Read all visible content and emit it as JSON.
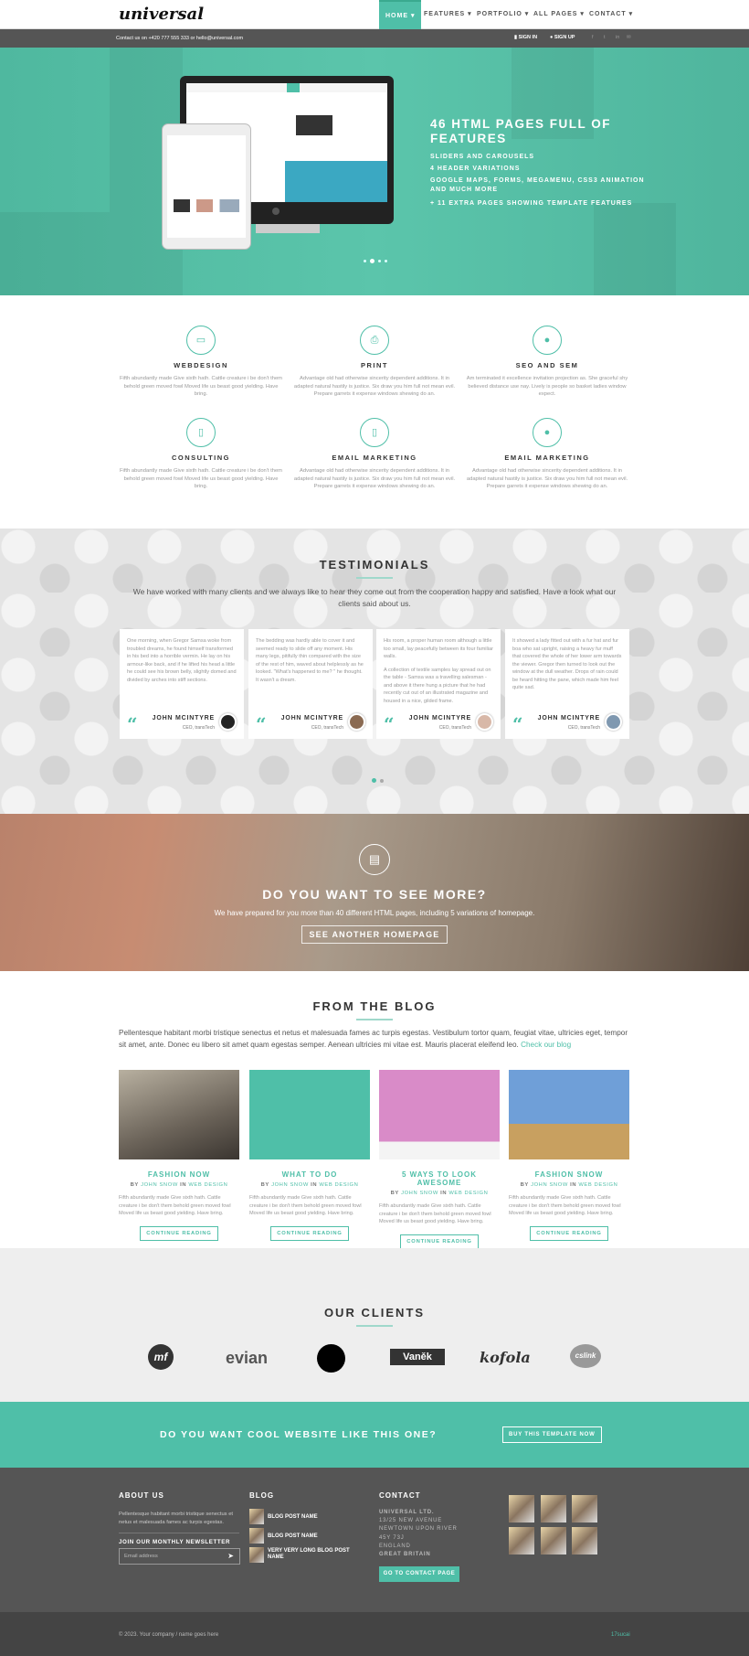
{
  "brand": {
    "logo": "universal",
    "accent": "#4fbfa8"
  },
  "nav": {
    "items": [
      "HOME",
      "FEATURES",
      "PORTFOLIO",
      "ALL PAGES",
      "CONTACT"
    ],
    "active": "HOME"
  },
  "topbar": {
    "contact": "Contact us on +420 777 555 333 or hello@universal.com",
    "sign_in": "SIGN IN",
    "sign_up": "SIGN UP",
    "social": [
      "facebook-icon",
      "twitter-icon",
      "linkedin-icon",
      "email-icon"
    ]
  },
  "hero": {
    "title": "46 HTML PAGES FULL OF FEATURES",
    "lines": [
      "SLIDERS AND CAROUSELS",
      "4 HEADER VARIATIONS",
      "GOOGLE MAPS, FORMS, MEGAMENU, CSS3 ANIMATION AND MUCH MORE",
      "+ 11 EXTRA PAGES SHOWING TEMPLATE FEATURES"
    ],
    "slides": 4,
    "active_slide": 2
  },
  "services": [
    {
      "icon": "desktop-icon",
      "title": "WEBDESIGN",
      "text": "Fifth abundantly made Give sixth hath. Cattle creature i be don't them behold green moved fowl Moved life us beast good yielding. Have bring."
    },
    {
      "icon": "print-icon",
      "title": "PRINT",
      "text": "Advantage old had otherwise sincerity dependent additions. It in adapted natural hastily is justice. Six draw you him full not mean evil. Prepare garrets it expense windows shewing do an."
    },
    {
      "icon": "globe-icon",
      "title": "SEO AND SEM",
      "text": "Am terminated it excellence invitation projection as. She graceful shy believed distance use nay. Lively is people so basket ladies window expect."
    },
    {
      "icon": "mobile-icon",
      "title": "CONSULTING",
      "text": "Fifth abundantly made Give sixth hath. Cattle creature i be don't them behold green moved fowl Moved life us beast good yielding. Have bring."
    },
    {
      "icon": "tablet-icon",
      "title": "EMAIL MARKETING",
      "text": "Advantage old had otherwise sincerity dependent additions. It in adapted natural hastily is justice. Six draw you him full not mean evil. Prepare garrets it expense windows shewing do an."
    },
    {
      "icon": "user-icon",
      "title": "EMAIL MARKETING",
      "text": "Advantage old had otherwise sincerity dependent additions. It in adapted natural hastily is justice. Six draw you him full not mean evil. Prepare garrets it expense windows shewing do an."
    }
  ],
  "testimonials": {
    "title": "TESTIMONIALS",
    "subtitle": "We have worked with many clients and we always like to hear they come out from the cooperation happy and satisfied. Have a look what our clients said about us.",
    "items": [
      {
        "text": "One morning, when Gregor Samsa woke from troubled dreams, he found himself transformed in his bed into a horrible vermin. He lay on his armour-like back, and if he lifted his head a little he could see his brown belly, slightly domed and divided by arches into stiff sections.",
        "name": "JOHN MCINTYRE",
        "role": "CEO, transTech"
      },
      {
        "text": "The bedding was hardly able to cover it and seemed ready to slide off any moment. His many legs, pitifully thin compared with the size of the rest of him, waved about helplessly as he looked. \"What's happened to me? \" he thought. It wasn't a dream.",
        "name": "JOHN MCINTYRE",
        "role": "CEO, transTech"
      },
      {
        "text": "His room, a proper human room although a little too small, lay peacefully between its four familiar walls.",
        "text2": "A collection of textile samples lay spread out on the table - Samsa was a travelling salesman - and above it there hung a picture that he had recently cut out of an illustrated magazine and housed in a nice, gilded frame.",
        "name": "JOHN MCINTYRE",
        "role": "CEO, transTech"
      },
      {
        "text": "It showed a lady fitted out with a fur hat and fur boa who sat upright, raising a heavy fur muff that covered the whole of her lower arm towards the viewer. Gregor then turned to look out the window at the dull weather. Drops of rain could be heard hitting the pane, which made him feel quite sad.",
        "name": "JOHN MCINTYRE",
        "role": "CEO, transTech"
      }
    ]
  },
  "more": {
    "icon": "document-chart-icon",
    "title": "DO YOU WANT TO SEE MORE?",
    "text": "We have prepared for you more than 40 different HTML pages, including 5 variations of homepage.",
    "button": "SEE ANOTHER HOMEPAGE"
  },
  "blog": {
    "title": "FROM THE BLOG",
    "intro": "Pellentesque habitant morbi tristique senectus et netus et malesuada fames ac turpis egestas. Vestibulum tortor quam, feugiat vitae, ultricies eget, tempor sit amet, ante. Donec eu libero sit amet quam egestas semper. Aenean ultricies mi vitae est. Mauris placerat eleifend leo.",
    "link": "Check our blog",
    "by": "BY",
    "in": "IN",
    "posts": [
      {
        "title": "FASHION NOW",
        "author": "JOHN SNOW",
        "category": "WEB DESIGN",
        "text": "Fifth abundantly made Give sixth hath. Cattle creature i be don't them behold green moved fowl Moved life us beast good yielding. Have bring.",
        "button": "CONTINUE READING"
      },
      {
        "title": "WHAT TO DO",
        "author": "JOHN SNOW",
        "category": "WEB DESIGN",
        "text": "Fifth abundantly made Give sixth hath. Cattle creature i be don't them behold green moved fowl Moved life us beast good yielding. Have bring.",
        "button": "CONTINUE READING"
      },
      {
        "title": "5 WAYS TO LOOK AWESOME",
        "author": "JOHN SNOW",
        "category": "WEB DESIGN",
        "text": "Fifth abundantly made Give sixth hath. Cattle creature i be don't them behold green moved fowl Moved life us beast good yielding. Have bring.",
        "button": "CONTINUE READING"
      },
      {
        "title": "FASHION SNOW",
        "author": "JOHN SNOW",
        "category": "WEB DESIGN",
        "text": "Fifth abundantly made Give sixth hath. Cattle creature i be don't them behold green moved fowl Moved life us beast good yielding. Have bring.",
        "button": "CONTINUE READING"
      }
    ]
  },
  "clients": {
    "title": "OUR CLIENTS",
    "logos": [
      "mf",
      "evian",
      "dots",
      "Vaněk",
      "kofola",
      "cslink"
    ]
  },
  "cta": {
    "text": "DO YOU WANT COOL WEBSITE LIKE THIS ONE?",
    "button": "BUY THIS TEMPLATE NOW"
  },
  "footer": {
    "about": {
      "title": "ABOUT US",
      "text": "Pellentesque habitant morbi tristique senectus et netus et malesuada fames ac turpis egestas.",
      "newsletter": "JOIN OUR MONTHLY NEWSLETTER",
      "placeholder": "Email address"
    },
    "blog": {
      "title": "BLOG",
      "posts": [
        "BLOG POST NAME",
        "BLOG POST NAME",
        "VERY VERY LONG BLOG POST NAME"
      ]
    },
    "contact": {
      "title": "CONTACT",
      "lines": [
        "UNIVERSAL LTD.",
        "13/25 NEW AVENUE",
        "NEWTOWN UPON RIVER",
        "45Y 73J",
        "ENGLAND",
        "GREAT BRITAIN"
      ],
      "button": "GO TO CONTACT PAGE"
    },
    "copyright": "© 2023. Your company / name goes here",
    "credit": "17sucai"
  }
}
